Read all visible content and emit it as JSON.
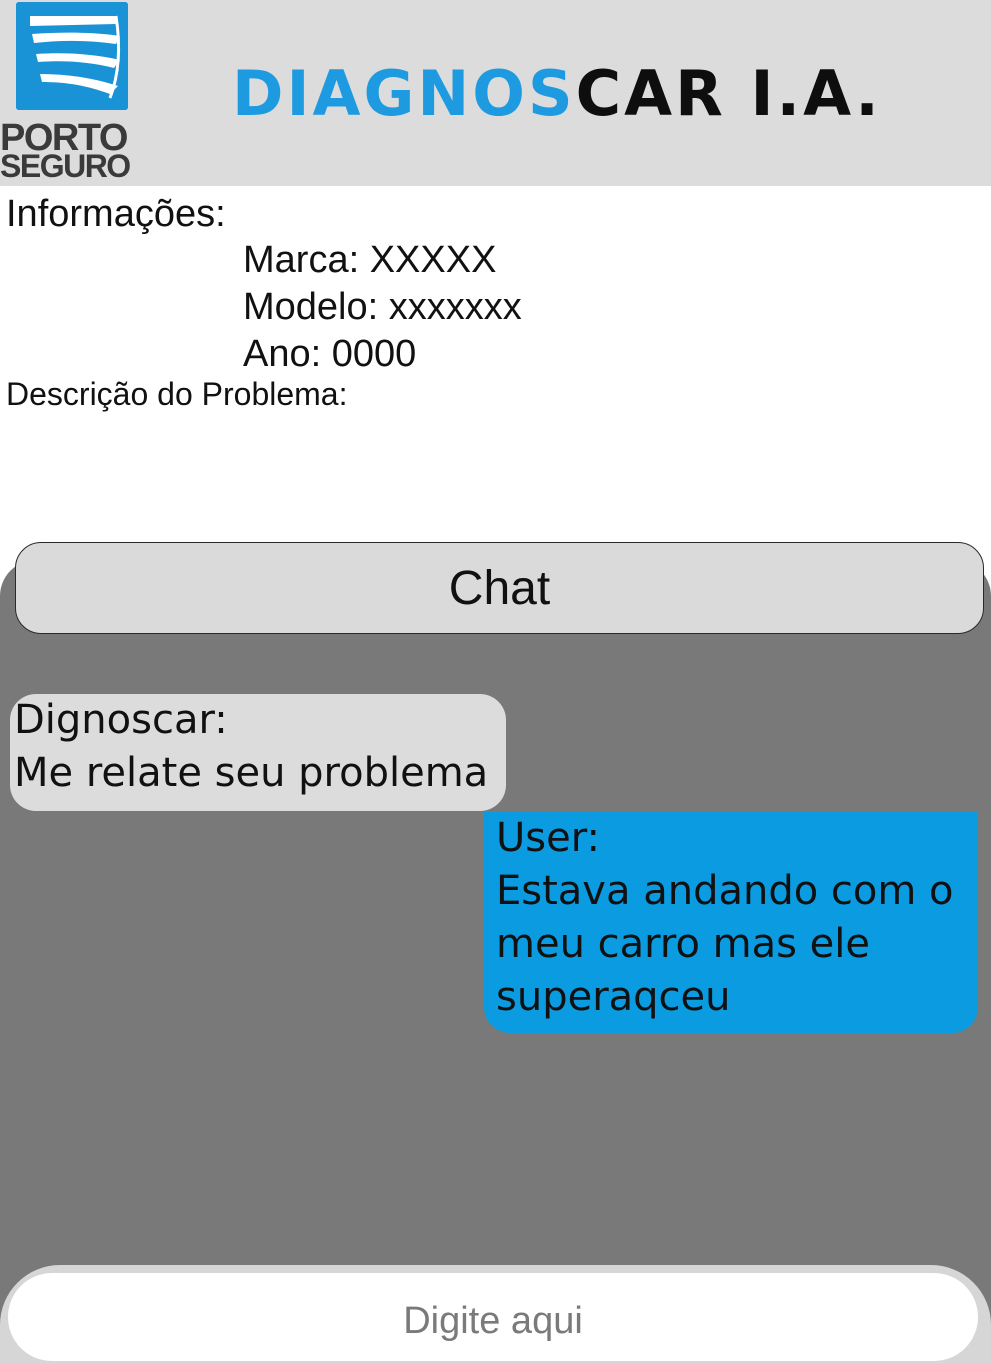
{
  "header": {
    "logo": {
      "line1": "PORTO",
      "line2": "SEGURO"
    },
    "title_part1": "DIAGNOS",
    "title_part2": "CAR I.A.",
    "colors": {
      "header_bg": "#dcdcdc",
      "brand_blue": "#1e9be0",
      "logo_blue": "#1a93d6"
    }
  },
  "info": {
    "label": "Informações:",
    "marca": "Marca: XXXXX",
    "modelo": "Modelo: xxxxxxx",
    "ano": "Ano: 0000",
    "description_label": "Descrição do Problema:"
  },
  "chat": {
    "title": "Chat",
    "colors": {
      "panel_bg": "#797979",
      "bot_bubble": "#dcdcdc",
      "user_bubble": "#0a9be0"
    },
    "messages": [
      {
        "sender": "Dignoscar:",
        "lines": [
          "Me relate seu problema"
        ]
      },
      {
        "sender": "User:",
        "lines": [
          "Estava andando com o",
          "meu carro mas ele",
          "superaqceu"
        ]
      }
    ],
    "input": {
      "placeholder": "Digite aqui",
      "value": ""
    }
  }
}
